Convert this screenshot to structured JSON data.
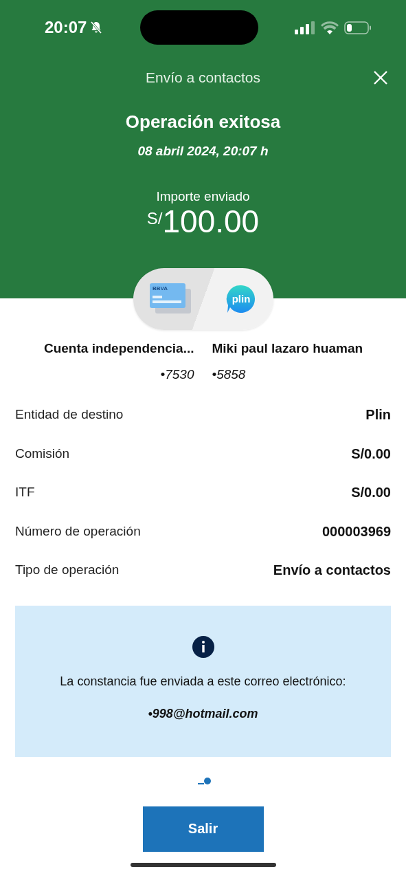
{
  "status_bar": {
    "time": "20:07"
  },
  "header": {
    "title": "Envío a contactos"
  },
  "result": {
    "title": "Operación exitosa",
    "date": "08 abril 2024, 20:07 h",
    "amount_label": "Importe enviado",
    "amount": "$^{S/}$100.00"
  },
  "transfer": {
    "from_logo": "BBVA",
    "to_logo": "plin",
    "parties": [
      {
        "name": "Cuenta independencia...",
        "number": "•7530"
      },
      {
        "name": "Miki paul lazaro huaman",
        "number": "•5858"
      }
    ]
  },
  "details": [
    {
      "label": "Entidad de destino",
      "value": "Plin"
    },
    {
      "label": "Comisión",
      "value": "S/0.00"
    },
    {
      "label": "ITF",
      "value": "S/0.00"
    },
    {
      "label": "Número de operación",
      "value": "000003969"
    },
    {
      "label": "Tipo de operación",
      "value": "Envío a contactos"
    }
  ],
  "notice": {
    "text": "La constancia fue enviada a este correo electrónico:",
    "email": "•998@hotmail.com"
  },
  "button": "Salir"
}
